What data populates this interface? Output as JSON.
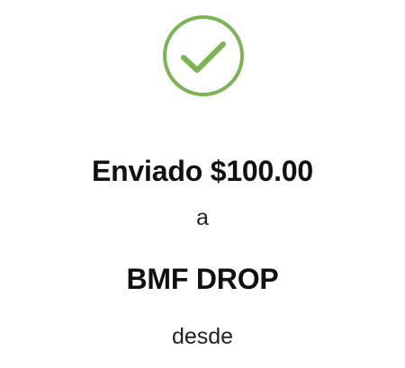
{
  "confirmation": {
    "status_icon": "check-circle-icon",
    "accent_color": "#7bb552",
    "sent_label": "Enviado $100.00",
    "to_label": "a",
    "recipient_name": "BMF DROP",
    "from_label": "desde"
  }
}
